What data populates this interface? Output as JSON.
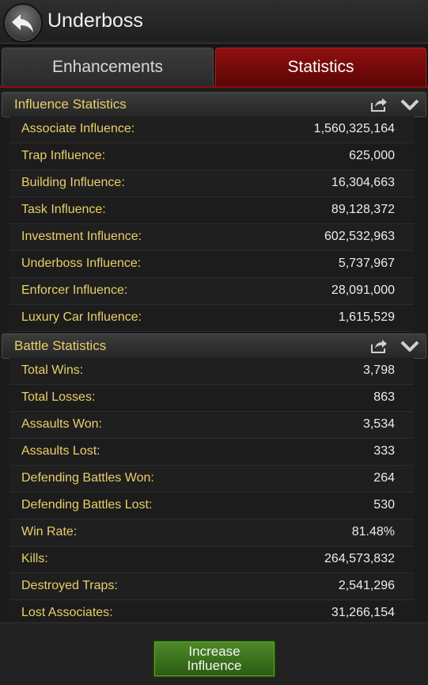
{
  "header": {
    "title": "Underboss"
  },
  "tabs": [
    {
      "label": "Enhancements",
      "active": false
    },
    {
      "label": "Statistics",
      "active": true
    }
  ],
  "influence": {
    "title": "Influence Statistics",
    "rows": [
      {
        "label": "Associate Influence:",
        "value": "1,560,325,164"
      },
      {
        "label": "Trap Influence:",
        "value": "625,000"
      },
      {
        "label": "Building Influence:",
        "value": "16,304,663"
      },
      {
        "label": "Task Influence:",
        "value": "89,128,372"
      },
      {
        "label": "Investment Influence:",
        "value": "602,532,963"
      },
      {
        "label": "Underboss Influence:",
        "value": "5,737,967"
      },
      {
        "label": "Enforcer Influence:",
        "value": "28,091,000"
      },
      {
        "label": "Luxury Car Influence:",
        "value": "1,615,529"
      }
    ]
  },
  "battle": {
    "title": "Battle Statistics",
    "rows": [
      {
        "label": "Total Wins:",
        "value": "3,798"
      },
      {
        "label": "Total Losses:",
        "value": "863"
      },
      {
        "label": "Assaults Won:",
        "value": "3,534"
      },
      {
        "label": "Assaults Lost:",
        "value": "333"
      },
      {
        "label": "Defending Battles Won:",
        "value": "264"
      },
      {
        "label": "Defending Battles Lost:",
        "value": "530"
      },
      {
        "label": "Win Rate:",
        "value": "81.48%"
      },
      {
        "label": "Kills:",
        "value": "264,573,832"
      },
      {
        "label": "Destroyed Traps:",
        "value": "2,541,296"
      },
      {
        "label": "Lost Associates:",
        "value": "31,266,154"
      }
    ]
  },
  "footer": {
    "button_line1": "Increase",
    "button_line2": "Influence"
  },
  "colors": {
    "accent_tab": "#8f1010",
    "label_gold": "#e9cf6a",
    "button_green": "#4d8a2a"
  },
  "icons": {
    "back": "back-arrow-icon",
    "share": "share-icon",
    "collapse": "chevron-down-icon"
  }
}
